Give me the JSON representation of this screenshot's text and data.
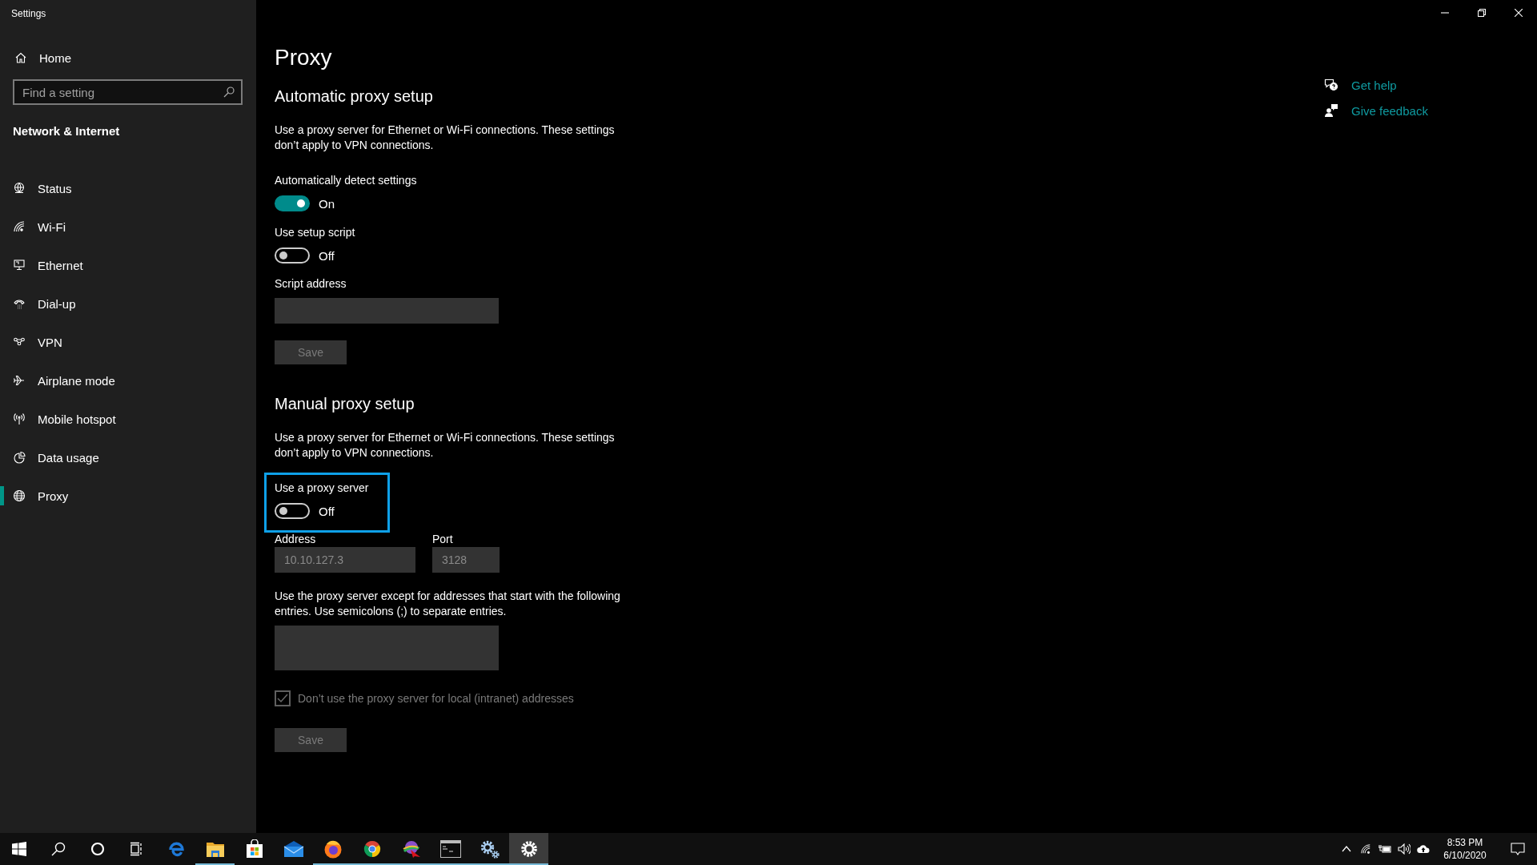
{
  "window": {
    "title": "Settings",
    "controls": [
      {
        "kind": "minimize"
      },
      {
        "kind": "restore"
      },
      {
        "kind": "close"
      }
    ]
  },
  "sidebar": {
    "home": "Home",
    "search": {
      "placeholder": "Find a setting"
    },
    "section": "Network & Internet",
    "items": [
      {
        "label": "Status",
        "kind": "status",
        "selected": false
      },
      {
        "label": "Wi-Fi",
        "kind": "wifi",
        "selected": false
      },
      {
        "label": "Ethernet",
        "kind": "ethernet",
        "selected": false
      },
      {
        "label": "Dial-up",
        "kind": "dialup",
        "selected": false
      },
      {
        "label": "VPN",
        "kind": "vpn",
        "selected": false
      },
      {
        "label": "Airplane mode",
        "kind": "airplane",
        "selected": false
      },
      {
        "label": "Mobile hotspot",
        "kind": "hotspot",
        "selected": false
      },
      {
        "label": "Data usage",
        "kind": "data",
        "selected": false
      },
      {
        "label": "Proxy",
        "kind": "proxy",
        "selected": true
      }
    ]
  },
  "page": {
    "title": "Proxy",
    "sections": [
      {
        "heading": "Automatic proxy setup",
        "description": "Use a proxy server for Ethernet or Wi-Fi connections. These settings don’t apply to VPN connections.",
        "controls": [
          {
            "kind": "toggle",
            "label": "Automatically detect settings",
            "on": true,
            "state_text": "On",
            "highlighted": false
          },
          {
            "kind": "toggle",
            "label": "Use setup script",
            "on": false,
            "state_text": "Off",
            "highlighted": false
          },
          {
            "kind": "text_field",
            "label": "Script address"
          },
          {
            "kind": "button",
            "label": "Save",
            "disabled": true
          }
        ]
      },
      {
        "heading": "Manual proxy setup",
        "description": "Use a proxy server for Ethernet or Wi-Fi connections. These settings don’t apply to VPN connections.",
        "controls": [
          {
            "kind": "toggle",
            "label": "Use a proxy server",
            "on": false,
            "state_text": "Off",
            "highlighted": true
          },
          {
            "kind": "field_pair",
            "fields": [
              {
                "label": "Address",
                "value": "10.10.127.3",
                "disabled": true
              },
              {
                "label": "Port",
                "value": "3128",
                "disabled": true
              }
            ]
          },
          {
            "kind": "text_area",
            "label": "Use the proxy server except for addresses that start with the following entries. Use semicolons (;) to separate entries."
          },
          {
            "kind": "checkbox",
            "label": "Don’t use the proxy server for local (intranet) addresses",
            "checked": true,
            "disabled": true
          },
          {
            "kind": "button",
            "label": "Save",
            "disabled": true
          }
        ]
      }
    ]
  },
  "help_links": [
    {
      "label": "Get help",
      "kind": "help"
    },
    {
      "label": "Give feedback",
      "kind": "feedback"
    }
  ],
  "taskbar": {
    "apps": [
      {
        "kind": "start",
        "running": false,
        "active": false
      },
      {
        "kind": "search",
        "running": false,
        "active": false
      },
      {
        "kind": "cortana",
        "running": false,
        "active": false
      },
      {
        "kind": "taskview",
        "running": false,
        "active": false
      },
      {
        "kind": "edge",
        "running": false,
        "active": false
      },
      {
        "kind": "explorer",
        "running": true,
        "active": false
      },
      {
        "kind": "store",
        "running": false,
        "active": false
      },
      {
        "kind": "mail",
        "running": false,
        "active": false
      },
      {
        "kind": "firefox",
        "running": true,
        "active": false
      },
      {
        "kind": "chrome",
        "running": true,
        "active": false
      },
      {
        "kind": "sphere",
        "running": true,
        "active": false
      },
      {
        "kind": "terminal",
        "running": true,
        "active": false
      },
      {
        "kind": "gears",
        "running": true,
        "active": false
      },
      {
        "kind": "settings",
        "running": true,
        "active": true
      }
    ],
    "tray": {
      "icons": [
        {
          "kind": "chevron"
        },
        {
          "kind": "wifi"
        },
        {
          "kind": "battery"
        },
        {
          "kind": "volume"
        },
        {
          "kind": "cloud"
        }
      ],
      "time": "8:53 PM",
      "date": "6/10/2020"
    }
  }
}
